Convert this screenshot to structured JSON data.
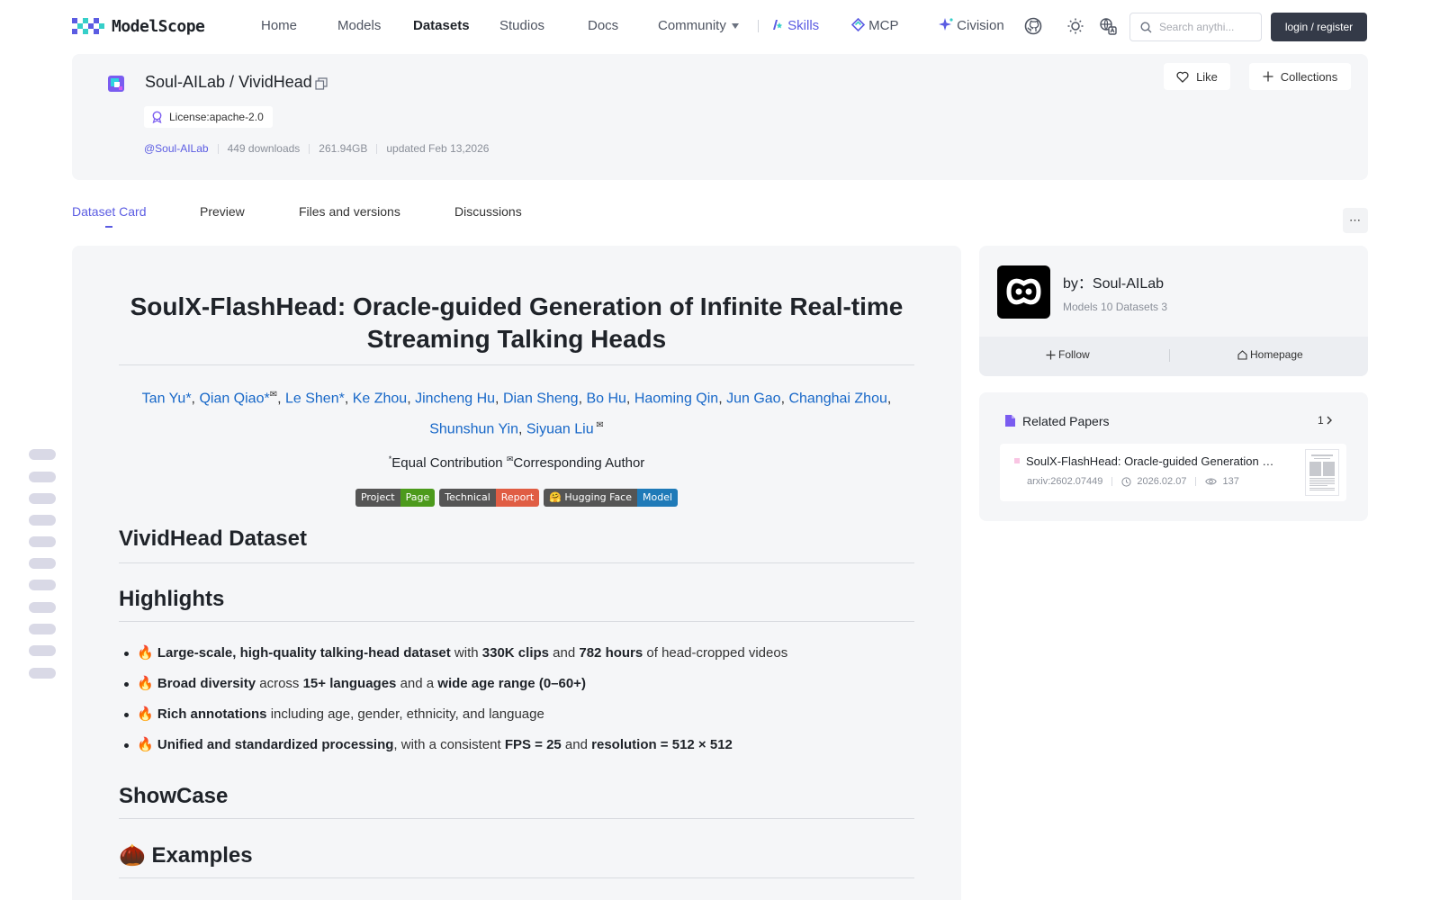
{
  "nav": {
    "logo_text": "ModelScope",
    "links": [
      "Home",
      "Models",
      "Datasets",
      "Studios",
      "Docs",
      "Community",
      "Skills",
      "MCP",
      "Civision"
    ],
    "active": "Datasets",
    "search_placeholder": "Search anythi...",
    "login_label": "login / register",
    "brand_color": "#5b5ce2"
  },
  "dataset": {
    "owner": "Soul-AILab",
    "name": "VividHead",
    "title": "Soul-AILab / VividHead",
    "license": "License:apache-2.0",
    "owner_handle": "@Soul-AILab",
    "downloads": "449 downloads",
    "size": "261.94GB",
    "updated": "updated Feb 13,2026",
    "like_label": "Like",
    "collections_label": "Collections"
  },
  "tabs": [
    "Dataset Card",
    "Preview",
    "Files and versions",
    "Discussions"
  ],
  "active_tab": "Dataset Card",
  "more_label": "⋯",
  "article": {
    "title": "SoulX-FlashHead: Oracle-guided Generation of Infinite Real-time Streaming Talking Heads",
    "authors": [
      "Tan Yu*",
      "Qian Qiao*",
      "Le Shen*",
      "Ke Zhou",
      "Jincheng Hu",
      "Dian Sheng",
      "Bo Hu",
      "Haoming Qin",
      "Jun Gao",
      "Changhai Zhou",
      "Shunshun Yin",
      "Siyuan Liu"
    ],
    "sep": ", ",
    "mail_mark": "✉",
    "star_mark": "*",
    "equal": "Equal Contribution ",
    "corresponding": "Corresponding Author",
    "badges": [
      {
        "left": "Project",
        "right": "Page",
        "left_color": "#555555",
        "right_color": "#4c9a1c"
      },
      {
        "left": "Technical",
        "right": "Report",
        "left_color": "#555555",
        "right_color": "#e05d44"
      },
      {
        "left": "🤗 Hugging Face",
        "right": "Model",
        "left_color": "#555555",
        "right_color": "#1f7ab8"
      }
    ],
    "h_dataset": "VividHead Dataset",
    "h_highlights": "Highlights",
    "highlights": [
      [
        [
          "b",
          "Large-scale, high-quality talking-head dataset"
        ],
        [
          "t",
          " with "
        ],
        [
          "b",
          "330K clips"
        ],
        [
          "t",
          " and "
        ],
        [
          "b",
          "782 hours"
        ],
        [
          "t",
          " of head-cropped videos"
        ]
      ],
      [
        [
          "b",
          "Broad diversity"
        ],
        [
          "t",
          " across "
        ],
        [
          "b",
          "15+ languages"
        ],
        [
          "t",
          " and a "
        ],
        [
          "b",
          "wide age range (0–60+)"
        ]
      ],
      [
        [
          "b",
          "Rich annotations"
        ],
        [
          "t",
          " including age, gender, ethnicity, and language"
        ]
      ],
      [
        [
          "b",
          "Unified and standardized processing"
        ],
        [
          "t",
          ", with a consistent "
        ],
        [
          "b",
          "FPS = 25"
        ],
        [
          "t",
          " and "
        ],
        [
          "b",
          "resolution = 512 × 512"
        ]
      ]
    ],
    "fire_emoji": "🔥",
    "h_showcase": "ShowCase",
    "h_examples": "🌰 Examples"
  },
  "org": {
    "name": "by：Soul-AILab",
    "stats": "Models 10  Datasets 3",
    "follow_label": "Follow",
    "homepage_label": "Homepage"
  },
  "papers": {
    "title": "Related Papers",
    "count": "1",
    "item": {
      "name": "SoulX-FlashHead: Oracle-guided Generation of Infinite Real-time Streaming Talking Heads",
      "arxiv": "arxiv:2602.07449",
      "date": "2026.02.07",
      "views": "137"
    }
  }
}
